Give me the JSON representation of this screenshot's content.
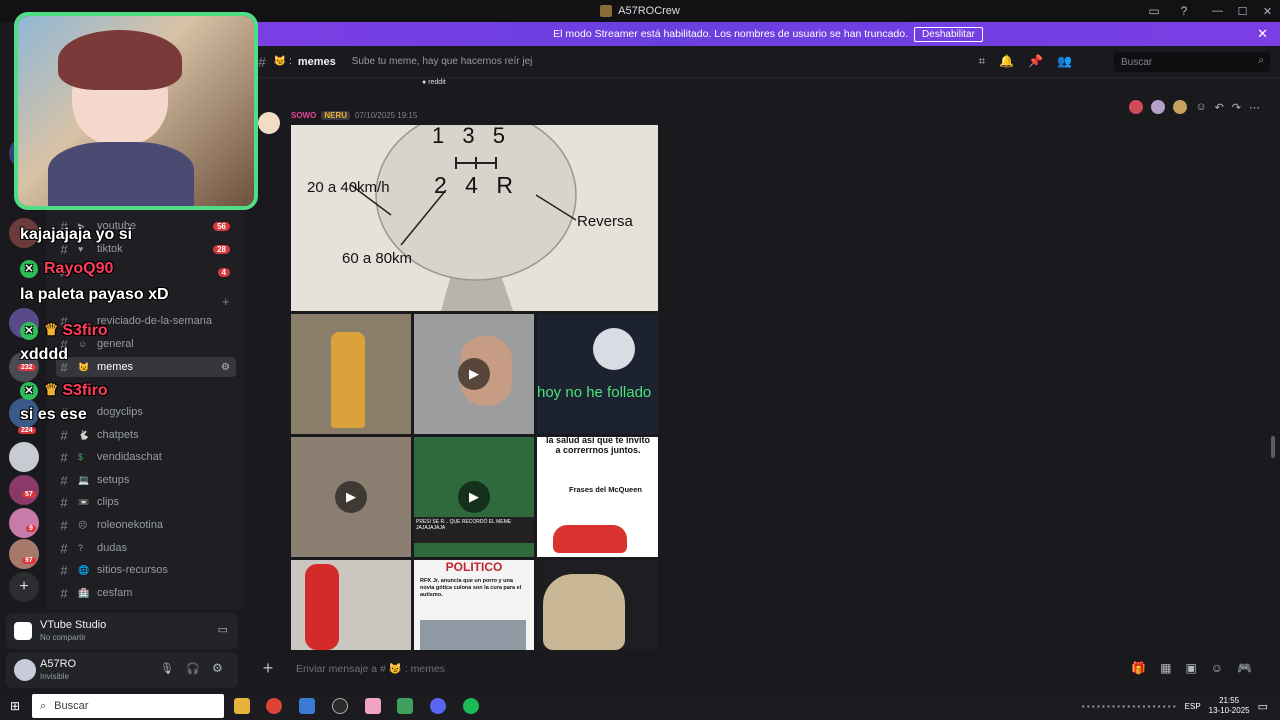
{
  "window": {
    "title": "A57ROCrew"
  },
  "banner": {
    "text": "El modo Streamer está habilitado. Los nombres de usuario se han truncado.",
    "button": "Deshabilitar"
  },
  "server_badges": [
    "232",
    "224",
    "57",
    "9",
    "97"
  ],
  "channels": {
    "items": [
      {
        "emoji": "▶",
        "label": "youtube",
        "badge": "56"
      },
      {
        "emoji": "♥",
        "label": "tiktok",
        "badge": "28"
      },
      {
        "emoji": "",
        "label": "",
        "badge": "4"
      },
      {
        "emoji": "",
        "label": "reviciado-de-la-semana",
        "badge": ""
      },
      {
        "emoji": "☺",
        "label": "general",
        "badge": ""
      },
      {
        "emoji": "😼",
        "label": "memes",
        "badge": ""
      },
      {
        "emoji": "",
        "label": "dogyclips",
        "badge": ""
      },
      {
        "emoji": "🐇",
        "label": "chatpets",
        "badge": ""
      },
      {
        "emoji": "$",
        "label": "vendidaschat",
        "badge": ""
      },
      {
        "emoji": "💻",
        "label": "setups",
        "badge": ""
      },
      {
        "emoji": "📼",
        "label": "clips",
        "badge": ""
      },
      {
        "emoji": "☹",
        "label": "roleonekotina",
        "badge": ""
      },
      {
        "emoji": "?",
        "label": "dudas",
        "badge": ""
      },
      {
        "emoji": "🌐",
        "label": "sitios-recursos",
        "badge": ""
      },
      {
        "emoji": "🏥",
        "label": "cesfam",
        "badge": ""
      }
    ]
  },
  "voice": {
    "title": "VTube Studio",
    "subtitle": "No compartir"
  },
  "user": {
    "name": "A57RO",
    "status": "Invisible"
  },
  "header": {
    "channel": "memes",
    "topic": "Sube tu meme, hay que hacernos reír jej",
    "search_placeholder": "Buscar"
  },
  "message": {
    "prev_label": "reddit",
    "author": "SOWO",
    "tag": "NERU",
    "timestamp": "07/10/2025 19:15"
  },
  "meme_texts": {
    "gear_top": "1 3 5",
    "gear_bottom": "2 4 R",
    "speed1": "20 a 40km/h",
    "speed2": "60 a 80km",
    "reverse": "Reversa",
    "tile3": "hoy no he follado",
    "tile6a": "la salud así que te invito a correrrnos juntos.",
    "tile6b": "Frases del McQueen",
    "politico": "POLITICO",
    "politico_sub": "RFK Jr. anuncia que un porro y una novia gótica culona son la cura para el autismo.",
    "tile5_caption": "PRESI SE R... QUE RECORDÓ EL MEME JAJAJAJAJA"
  },
  "composer": {
    "placeholder": "Enviar mensaje a # 😼 : memes"
  },
  "overlay_chat": [
    {
      "name": "",
      "text": "kajajajaja yo si"
    },
    {
      "name": "RayoQ90",
      "text": "la paleta payaso xD"
    },
    {
      "name": "S3firo",
      "text": "xdddd"
    },
    {
      "name": "S3firo",
      "text": "si es ese"
    }
  ],
  "taskbar": {
    "search": "Buscar",
    "lang": "ESP",
    "time": "21:55",
    "date": "13-10-2025"
  },
  "colors": {
    "accent": "#5865f2",
    "banner": "#7b3fe4",
    "webcam_border": "#4fde84",
    "mention": "#da373c"
  }
}
